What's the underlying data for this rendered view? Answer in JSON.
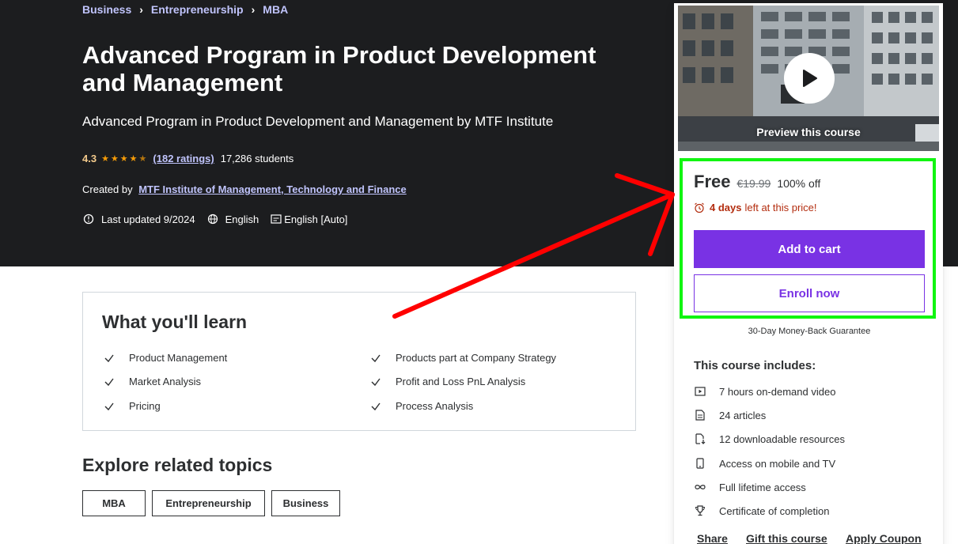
{
  "breadcrumb": [
    "Business",
    "Entrepreneurship",
    "MBA"
  ],
  "course": {
    "title": "Advanced Program in Product Development and Management",
    "subtitle": "Advanced Program in Product Development and Management by MTF Institute",
    "rating": "4.3",
    "stars_value": 4.3,
    "ratings_count": "(182 ratings)",
    "students": "17,286 students",
    "created_by_label": "Created by",
    "author": "MTF Institute of Management, Technology and Finance",
    "last_updated": "Last updated 9/2024",
    "language": "English",
    "captions": "English [Auto]"
  },
  "learn": {
    "title": "What you'll learn",
    "items": [
      "Product Management",
      "Products part at Company Strategy",
      "Market Analysis",
      "Profit and Loss PnL Analysis",
      "Pricing",
      "Process Analysis"
    ]
  },
  "explore": {
    "title": "Explore related topics",
    "topics": [
      "MBA",
      "Entrepreneurship",
      "Business"
    ]
  },
  "sidebar": {
    "preview_label": "Preview this course",
    "price": "Free",
    "original_price": "€19.99",
    "discount": "100% off",
    "timer_bold": "4 days",
    "timer_text": "left at this price!",
    "add_to_cart": "Add to cart",
    "enroll_now": "Enroll now",
    "guarantee": "30-Day Money-Back Guarantee",
    "includes_title": "This course includes:",
    "includes": [
      "7 hours on-demand video",
      "24 articles",
      "12 downloadable resources",
      "Access on mobile and TV",
      "Full lifetime access",
      "Certificate of completion"
    ],
    "links": [
      "Share",
      "Gift this course",
      "Apply Coupon"
    ]
  },
  "colors": {
    "hero_bg": "#1c1d1f",
    "link_purple": "#c0c4fc",
    "accent": "#7932e4",
    "star": "#f69c08",
    "timer_red": "#b32d0f",
    "highlight_green": "#11f511",
    "arrow_red": "#ff0000"
  }
}
